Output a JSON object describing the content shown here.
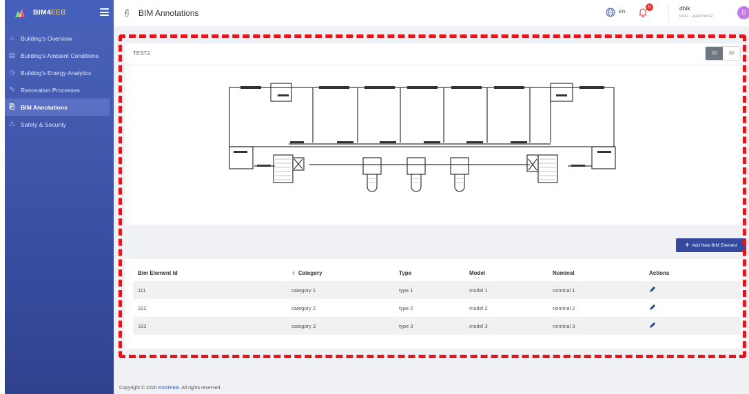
{
  "brand": {
    "name_main": "BIM4",
    "name_accent": "EEB"
  },
  "sidebar": {
    "items": [
      {
        "label": "Building's Overview",
        "icon": "home-icon"
      },
      {
        "label": "Building's Ambient Conditions",
        "icon": "chart-icon"
      },
      {
        "label": "Building's Energy Analytics",
        "icon": "clock-icon"
      },
      {
        "label": "Renovation Processes",
        "icon": "brush-icon"
      },
      {
        "label": "BIM Annotations",
        "icon": "paperclip-icon",
        "active": true
      },
      {
        "label": "Safety & Security",
        "icon": "warning-icon"
      }
    ]
  },
  "header": {
    "page_title": "BIM Annotations",
    "language": "EN",
    "notification_count": "0",
    "user_name": "dbik",
    "user_sub": "test2 - apartment2",
    "avatar_initial": "D"
  },
  "viewer": {
    "title": "TEST2",
    "mode_2d": "2D",
    "mode_3d": "3D",
    "active_mode": "2D"
  },
  "actions": {
    "add_button": "Add New BIM Element"
  },
  "table": {
    "headers": [
      "Bim Element Id",
      "Category",
      "Type",
      "Model",
      "Nominal",
      "Actions"
    ],
    "rows": [
      [
        "111",
        "category 1",
        "type 1",
        "model 1",
        "nominal 1"
      ],
      [
        "222",
        "category 2",
        "type 2",
        "model 2",
        "nominal 2"
      ],
      [
        "333",
        "category 3",
        "type 3",
        "model 3",
        "nominal 3"
      ]
    ]
  },
  "footer": {
    "prefix": "Copyright © 2020",
    "link": "BIM4EEB",
    "suffix": ". All rights reserved."
  },
  "colors": {
    "sidebar": "#3b51a6",
    "accent_button": "#344a9e",
    "highlight_dash": "#e3161b",
    "badge": "#e53935",
    "avatar": "#c17be8"
  }
}
